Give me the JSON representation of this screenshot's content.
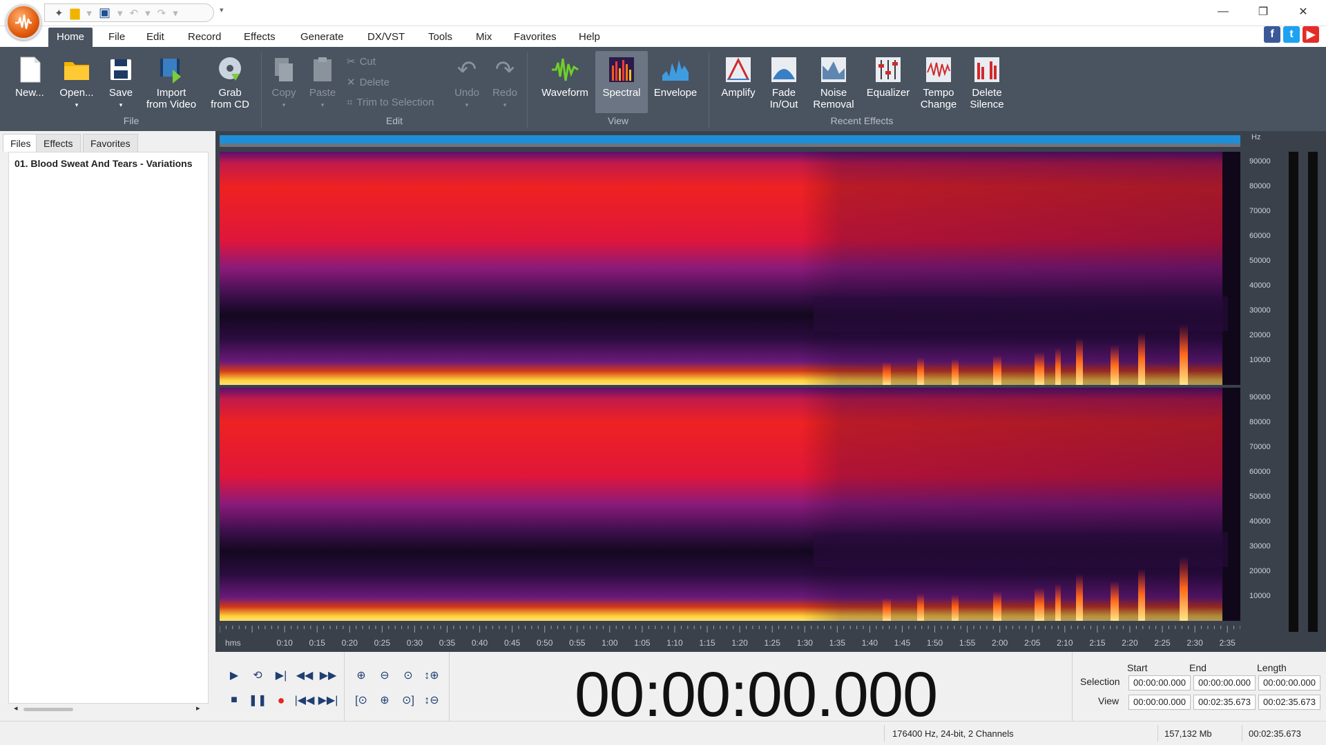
{
  "menu": {
    "tabs": [
      "Home",
      "File",
      "Edit",
      "Record",
      "Effects",
      "Generate",
      "DX/VST",
      "Tools",
      "Mix",
      "Favorites",
      "Help"
    ],
    "active": "Home"
  },
  "ribbon": {
    "file": {
      "new": "New...",
      "open": "Open...",
      "save": "Save",
      "import_line1": "Import",
      "import_line2": "from Video",
      "grab_line1": "Grab",
      "grab_line2": "from CD",
      "group": "File"
    },
    "edit": {
      "copy": "Copy",
      "paste": "Paste",
      "cut": "Cut",
      "delete": "Delete",
      "trim": "Trim to Selection",
      "undo": "Undo",
      "redo": "Redo",
      "group": "Edit"
    },
    "view": {
      "waveform": "Waveform",
      "spectral": "Spectral",
      "envelope": "Envelope",
      "group": "View"
    },
    "effects": {
      "amplify": "Amplify",
      "fade_line1": "Fade",
      "fade_line2": "In/Out",
      "noise_line1": "Noise",
      "noise_line2": "Removal",
      "equalizer": "Equalizer",
      "tempo_line1": "Tempo",
      "tempo_line2": "Change",
      "delsil_line1": "Delete",
      "delsil_line2": "Silence",
      "group": "Recent Effects"
    }
  },
  "panel": {
    "tabs": [
      "Files",
      "Effects",
      "Favorites"
    ],
    "files": [
      "01. Blood Sweat And Tears - Variations"
    ]
  },
  "spectrum": {
    "hz_unit": "Hz",
    "hz_ticks": [
      "90000",
      "80000",
      "70000",
      "60000",
      "50000",
      "40000",
      "30000",
      "20000",
      "10000"
    ],
    "time_unit": "hms",
    "time_ticks": [
      "0:10",
      "0:15",
      "0:20",
      "0:25",
      "0:30",
      "0:35",
      "0:40",
      "0:45",
      "0:50",
      "0:55",
      "1:00",
      "1:05",
      "1:10",
      "1:15",
      "1:20",
      "1:25",
      "1:30",
      "1:35",
      "1:40",
      "1:45",
      "1:50",
      "1:55",
      "2:00",
      "2:05",
      "2:10",
      "2:15",
      "2:20",
      "2:25",
      "2:30",
      "2:35"
    ]
  },
  "transport": {
    "time": "00:00:00.000",
    "col_start": "Start",
    "col_end": "End",
    "col_length": "Length",
    "row_selection": "Selection",
    "row_view": "View",
    "selection": {
      "start": "00:00:00.000",
      "end": "00:00:00.000",
      "length": "00:00:00.000"
    },
    "view": {
      "start": "00:00:00.000",
      "end": "00:02:35.673",
      "length": "00:02:35.673"
    }
  },
  "status": {
    "format": "176400 Hz, 24-bit, 2 Channels",
    "size": "157,132 Mb",
    "duration": "00:02:35.673"
  },
  "icons": {
    "facebook": "facebook-icon",
    "twitter": "twitter-icon",
    "youtube": "youtube-icon"
  },
  "colors": {
    "ribbon": "#4a5360",
    "accent": "#1e8fd6"
  }
}
